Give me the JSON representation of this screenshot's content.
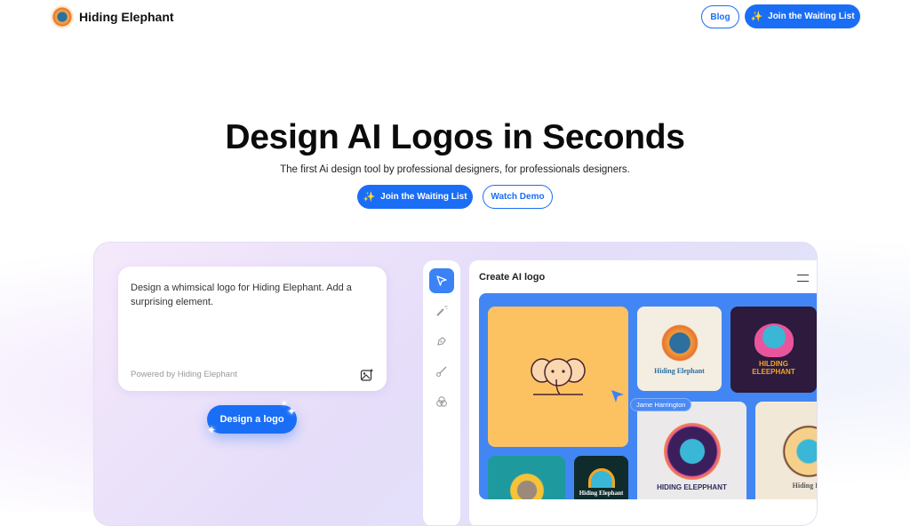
{
  "nav": {
    "brand": "Hiding Elephant",
    "blog_label": "Blog",
    "waitlist_label": "Join the Waiting List"
  },
  "hero": {
    "title": "Design AI Logos in Seconds",
    "subtitle": "The first Ai design tool by professional designers, for professionals designers.",
    "waitlist_label": "Join the Waiting List",
    "demo_label": "Watch Demo"
  },
  "demo": {
    "prompt_text": "Design a whimsical logo for Hiding Elephant. Add a surprising element.",
    "powered_by": "Powered by Hiding Elephant",
    "design_button": "Design a logo",
    "tools": [
      "select-tool",
      "magic-wand-tool",
      "pen-tool",
      "brush-tool",
      "blend-tool"
    ],
    "canvas_title": "Create AI logo",
    "cursor_user": "Jame Harrington",
    "tiles": [
      {
        "label": "",
        "bg": "#fcc262"
      },
      {
        "label": "Hiding Elephant",
        "bg": "#f4ede2"
      },
      {
        "label": "HILDING ELEEPHANT",
        "bg": "#2d1a3d"
      },
      {
        "label": "HIDING ELEPPHANT",
        "bg": "#ece9ea"
      },
      {
        "label": "Hiding Ele",
        "bg": "#f2e8d8"
      },
      {
        "label": "",
        "bg": "#1e9a9f"
      },
      {
        "label": "Hiding Elephant",
        "bg": "#0f2b2c"
      }
    ]
  },
  "colors": {
    "accent": "#1a6ef5"
  }
}
